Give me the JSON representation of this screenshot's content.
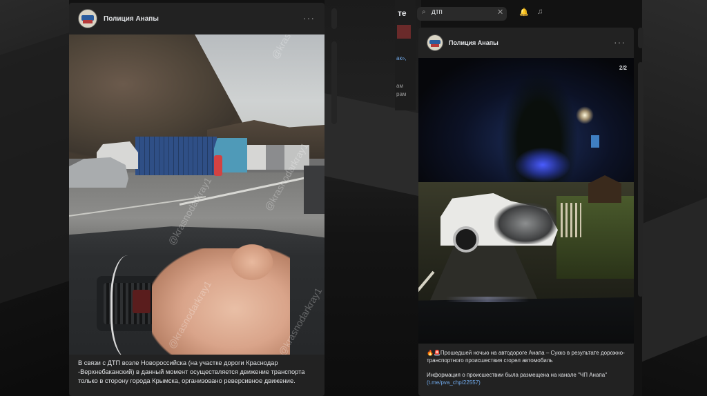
{
  "left_post": {
    "author": "Полиция Анапы",
    "more": "···",
    "watermark": "@krasnodarkray1",
    "text": "В связи с ДТП возле Новороссийска (на участке дороги Краснодар -Верхнебаканский) в данный момент осуществляется движение транспорта только в сторону города Крымска, организовано реверсивное движение."
  },
  "right_post": {
    "author": "Полиция Анапы",
    "more": "···",
    "photo_counter": "2/2",
    "text_line1": "🔥🚨Прошедшей ночью на автодороге Анапа – Сукко в результате дорожно-транспортного происшествия сгорел автомобиль",
    "text_line2": "Информация о происшествии была размещена на канале \"ЧП Анапа\"",
    "link_text": "(t.me/pva_chp/22557)"
  },
  "topbar": {
    "search_value": "дтп",
    "search_icon": "⌕",
    "clear_icon": "✕",
    "bell_icon": "🔔",
    "music_icon": "♫",
    "partial_title": "те"
  },
  "sidebar_fragments": [
    "ак»,",
    "ам",
    "рам"
  ]
}
